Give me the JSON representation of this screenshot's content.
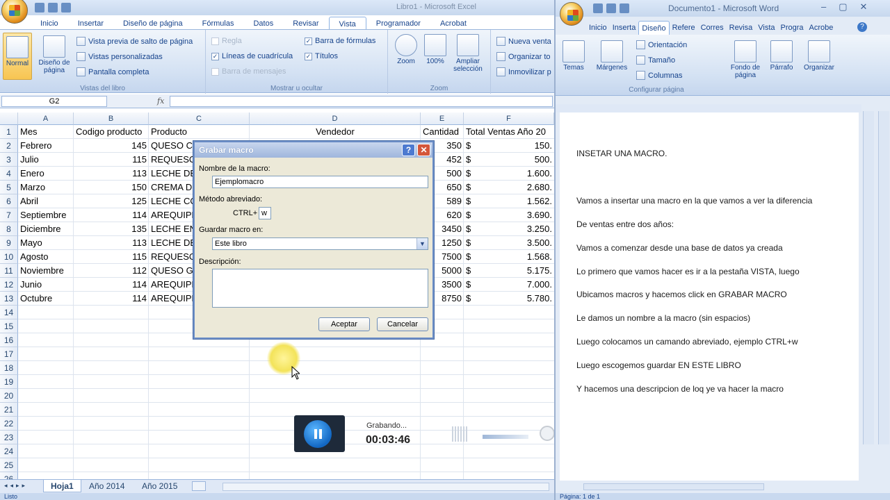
{
  "excel": {
    "title": "Libro1 - Microsoft Excel",
    "tabs": [
      "Inicio",
      "Insertar",
      "Diseño de página",
      "Fórmulas",
      "Datos",
      "Revisar",
      "Vista",
      "Programador",
      "Acrobat"
    ],
    "active_tab": "Vista",
    "ribbon": {
      "normal": "Normal",
      "page_layout": "Diseño de página",
      "page_break": "Vista previa de salto de página",
      "custom_views": "Vistas personalizadas",
      "full_screen": "Pantalla completa",
      "group_views": "Vistas del libro",
      "ruler": "Regla",
      "gridlines": "Líneas de cuadrícula",
      "message_bar": "Barra de mensajes",
      "formula_bar": "Barra de fórmulas",
      "headings": "Títulos",
      "group_show": "Mostrar u ocultar",
      "zoom": "Zoom",
      "zoom100": "100%",
      "zoom_sel": "Ampliar selección",
      "group_zoom": "Zoom",
      "new_window": "Nueva venta",
      "arrange": "Organizar to",
      "freeze": "Inmovilizar p"
    },
    "name_box": "G2",
    "fx": "fx",
    "columns": [
      "A",
      "B",
      "C",
      "D",
      "E",
      "F"
    ],
    "headers": [
      "Mes",
      "Codigo producto",
      "Producto",
      "Vendedor",
      "Cantidad",
      "Total Ventas Año 20"
    ],
    "rows": [
      [
        "Febrero",
        "145",
        "QUESO CR",
        "",
        "350",
        "$",
        "150."
      ],
      [
        "Julio",
        "115",
        "REQUESO",
        "",
        "452",
        "$",
        "500."
      ],
      [
        "Enero",
        "113",
        "LECHE DES",
        "",
        "500",
        "$",
        "1.600."
      ],
      [
        "Marzo",
        "150",
        "CREMA DE",
        "",
        "650",
        "$",
        "2.680."
      ],
      [
        "Abril",
        "125",
        "LECHE CO",
        "",
        "589",
        "$",
        "1.562."
      ],
      [
        "Septiembre",
        "114",
        "AREQUIPE",
        "",
        "620",
        "$",
        "3.690."
      ],
      [
        "Diciembre",
        "135",
        "LECHE EN",
        "",
        "3450",
        "$",
        "3.250."
      ],
      [
        "Mayo",
        "113",
        "LECHE DES",
        "",
        "1250",
        "$",
        "3.500."
      ],
      [
        "Agosto",
        "115",
        "REQUESO",
        "",
        "7500",
        "$",
        "1.568."
      ],
      [
        "Noviembre",
        "112",
        "QUESO GR",
        "",
        "5000",
        "$",
        "5.175."
      ],
      [
        "Junio",
        "114",
        "AREQUIPE",
        "",
        "3500",
        "$",
        "7.000."
      ],
      [
        "Octubre",
        "114",
        "AREQUIPE",
        "",
        "8750",
        "$",
        "5.780."
      ]
    ],
    "row_numbers": [
      "1",
      "2",
      "3",
      "4",
      "5",
      "6",
      "7",
      "8",
      "9",
      "10",
      "11",
      "12",
      "13",
      "14",
      "15",
      "16",
      "17",
      "18",
      "19",
      "20",
      "21",
      "22",
      "23",
      "24",
      "25",
      "26"
    ],
    "sheets": [
      "Hoja1",
      "Año 2014",
      "Año 2015"
    ],
    "status": "Listo"
  },
  "dialog": {
    "title": "Grabar macro",
    "help": "?",
    "close": "✕",
    "name_label": "Nombre de la macro:",
    "name_value": "Ejemplomacro",
    "shortcut_label": "Método abreviado:",
    "ctrl": "CTRL+",
    "shortcut_value": "w",
    "store_label": "Guardar macro en:",
    "store_value": "Este libro",
    "desc_label": "Descripción:",
    "ok": "Aceptar",
    "cancel": "Cancelar"
  },
  "recorder": {
    "status": "Grabando...",
    "time": "00:03:46"
  },
  "word": {
    "title": "Documento1 - Microsoft Word",
    "tabs": [
      "Inicio",
      "Insertar",
      "Diseño",
      "Referencias",
      "Correspondencia",
      "Revisar",
      "Vista",
      "Programador",
      "Acrobat"
    ],
    "tab_labels": [
      "Inicio",
      "Inserta",
      "Diseño",
      "Refere",
      "Corres",
      "Revisa",
      "Vista",
      "Progra",
      "Acrobe"
    ],
    "ribbon": {
      "themes": "Temas",
      "margins": "Márgenes",
      "orientation": "Orientación",
      "size": "Tamaño",
      "columns": "Columnas",
      "bg": "Fondo de página",
      "paragraph": "Párrafo",
      "arrange": "Organizar",
      "group": "Configurar página"
    },
    "lines": [
      "INSETAR UNA MACRO.",
      "Vamos a insertar una macro en la que vamos a ver la diferencia",
      "De ventas entre dos años:",
      "Vamos a comenzar desde una base de datos ya creada",
      "Lo primero que vamos hacer es ir a la pestaña VISTA, luego",
      "Ubicamos macros y hacemos click en GRABAR MACRO",
      "Le damos un nombre a la macro  (sin espacios)",
      "Luego colocamos un camando abreviado, ejemplo CTRL+w",
      "Luego escogemos guardar EN ESTE LIBRO",
      "Y hacemos una descripcion de loq ye va hacer la macro"
    ],
    "status": "Página: 1 de 1"
  }
}
